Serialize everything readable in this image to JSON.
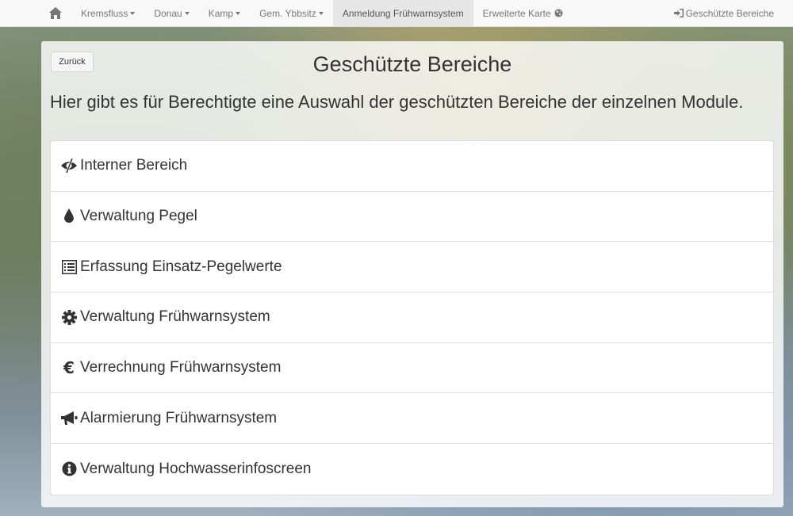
{
  "navbar": {
    "home_icon": "home-icon",
    "items": [
      {
        "label": "Kremsfluss",
        "dropdown": true
      },
      {
        "label": "Donau",
        "dropdown": true
      },
      {
        "label": "Kamp",
        "dropdown": true
      },
      {
        "label": "Gem. Ybbsitz",
        "dropdown": true
      },
      {
        "label": "Anmeldung Frühwarnsystem",
        "active": true
      },
      {
        "label": "Erweiterte Karte",
        "icon": "globe-icon"
      }
    ],
    "right": {
      "label": "Geschützte Bereiche",
      "icon": "sign-in-icon"
    }
  },
  "panel": {
    "back_label": "Zurück",
    "title": "Geschützte Bereiche",
    "intro": "Hier gibt es für Berechtigte eine Auswahl der geschützten Bereiche der einzelnen Module.",
    "items": [
      {
        "label": "Interner Bereich",
        "icon": "eye-slash-icon"
      },
      {
        "label": "Verwaltung Pegel",
        "icon": "drop-icon"
      },
      {
        "label": "Erfassung Einsatz-Pegelwerte",
        "icon": "list-alt-icon"
      },
      {
        "label": "Verwaltung Frühwarnsystem",
        "icon": "cog-icon"
      },
      {
        "label": "Verrechnung Frühwarnsystem",
        "icon": "euro-icon"
      },
      {
        "label": "Alarmierung Frühwarnsystem",
        "icon": "bullhorn-icon"
      },
      {
        "label": "Verwaltung Hochwasserinfoscreen",
        "icon": "info-sign-icon"
      }
    ]
  },
  "colors": {
    "navbar_bg": "#f8f8f8",
    "nav_text": "#777777",
    "active_bg": "#e6e6e6",
    "text": "#333333",
    "border": "#dddddd"
  }
}
